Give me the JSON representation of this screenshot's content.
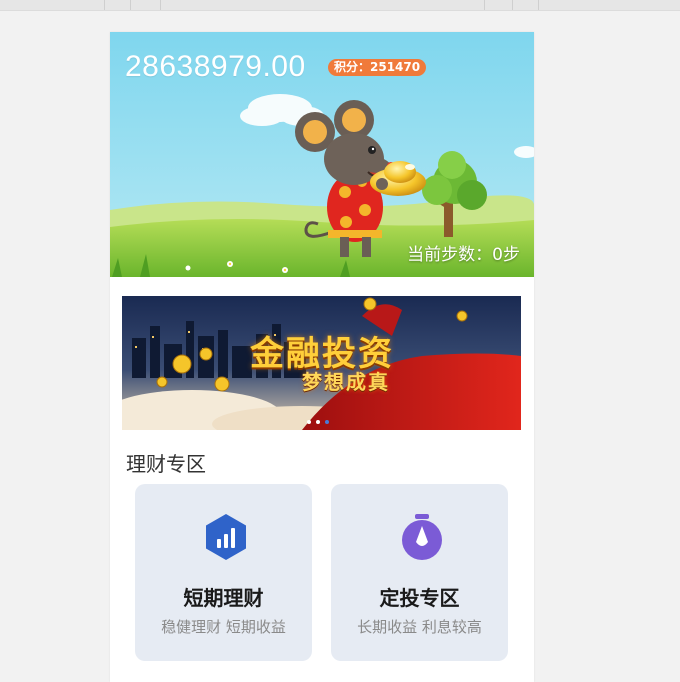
{
  "hero": {
    "balance": "28638979.00",
    "points_badge": "积分：251470",
    "steps": "当前步数：0步"
  },
  "banner": {
    "title": "金融投资",
    "subtitle": "梦想成真",
    "slide_count": 3,
    "active_slide": 3
  },
  "section": {
    "title": "理财专区"
  },
  "cards": [
    {
      "title": "短期理财",
      "subtitle": "稳健理财 短期收益",
      "icon": "chart-hexagon-icon"
    },
    {
      "title": "定投专区",
      "subtitle": "长期收益 利息较高",
      "icon": "stopwatch-icon"
    }
  ],
  "colors": {
    "badge": "#f07a3a",
    "sky": "#86d8ee",
    "grass": "#8ac73a",
    "card_bg": "#e6ebf3",
    "hexagon_icon": "#2f63c9",
    "stopwatch_icon": "#7b5bd6"
  }
}
